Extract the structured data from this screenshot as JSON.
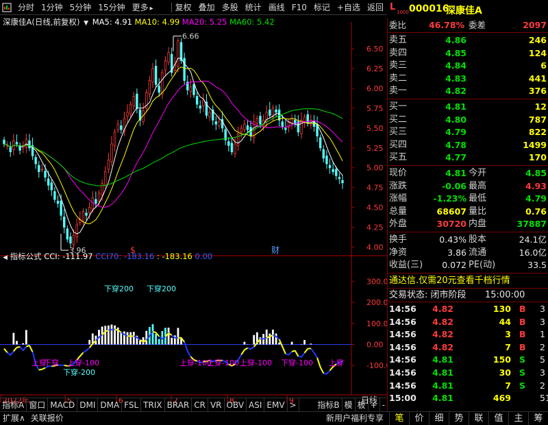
{
  "toolbar": {
    "items": [
      "分时",
      "1分钟",
      "5分钟",
      "15分钟",
      "更多"
    ],
    "more_arrow": "▸",
    "tools": [
      "复权",
      "叠加",
      "多股",
      "统计",
      "画线",
      "F10",
      "标记",
      "+自选",
      "返回"
    ]
  },
  "quote_header": {
    "l_badge": "L",
    "l_sub": "1000",
    "code": "000016",
    "name": "深康佳A"
  },
  "chart_title": {
    "name": "深康佳A",
    "mode": "(日线,前复权)",
    "ma5": "MA5: 4.91",
    "ma10": "MA10: 4.99",
    "ma20": "MA20: 5.25",
    "ma60": "MA60: 5.42"
  },
  "indicator_title": {
    "label": "指标公式",
    "cci": "CCI: -111.97",
    "cci70": "CCI70: -183.16",
    "ma": ": -183.16",
    "zero": "0.00"
  },
  "price_axis": [
    "6.50",
    "6.25",
    "6.00",
    "5.75",
    "5.50",
    "5.25",
    "5.00",
    "4.75",
    "4.50",
    "4.25",
    "4.00"
  ],
  "cci_axis": [
    "300.0",
    "200.0",
    "100.0",
    "0.00",
    "-100.0"
  ],
  "annotations": {
    "high": "6.66",
    "low": "3.96",
    "dollar_mark": "$",
    "cai_mark": "财",
    "down_cross_1": "下穿200",
    "down_cross_2": "下穿200",
    "down_cross_3": "下穿-200",
    "up_cross_label": "上穿-100",
    "down_cross_100": "下穿-100",
    "dense_labels": [
      "上穿",
      "下穿",
      "上穿-100",
      "上穿-100",
      "上穿-100",
      "上穿-100",
      "上穿"
    ]
  },
  "x_axis": [
    "2022年",
    "5",
    "6",
    "7",
    "8",
    "9",
    "日线"
  ],
  "bottom_tabs": [
    "指标A",
    "窗口",
    "MACD",
    "DMI",
    "DMA",
    "FSL",
    "TRIX",
    "BRAR",
    "CR",
    "VR",
    "OBV",
    "ASI",
    "EMV",
    ">",
    "指标B",
    "模",
    "板",
    "+",
    "-"
  ],
  "status_bar": {
    "expand": "扩展∧",
    "related": "关联报价",
    "promo": "新用户福利专享",
    "tabs": [
      "笔",
      "价",
      "细",
      "势",
      "联",
      "值",
      "主",
      "筹"
    ]
  },
  "weibi": {
    "label1": "委比",
    "value1": "46.78%",
    "label2": "委差",
    "value2": "2097"
  },
  "sell": [
    {
      "label": "卖五",
      "price": "4.86",
      "vol": "246"
    },
    {
      "label": "卖四",
      "price": "4.85",
      "vol": "124"
    },
    {
      "label": "卖三",
      "price": "4.84",
      "vol": "6"
    },
    {
      "label": "卖二",
      "price": "4.83",
      "vol": "441"
    },
    {
      "label": "卖一",
      "price": "4.82",
      "vol": "376"
    }
  ],
  "buy": [
    {
      "label": "买一",
      "price": "4.81",
      "vol": "12"
    },
    {
      "label": "买二",
      "price": "4.80",
      "vol": "787"
    },
    {
      "label": "买三",
      "price": "4.79",
      "vol": "822"
    },
    {
      "label": "买四",
      "price": "4.78",
      "vol": "1499"
    },
    {
      "label": "买五",
      "price": "4.77",
      "vol": "170"
    }
  ],
  "stats": [
    {
      "l1": "现价",
      "v1": "4.81",
      "c1": "green",
      "l2": "今开",
      "v2": "4.85",
      "c2": "green"
    },
    {
      "l1": "涨跌",
      "v1": "-0.06",
      "c1": "green",
      "l2": "最高",
      "v2": "4.93",
      "c2": "red"
    },
    {
      "l1": "涨幅",
      "v1": "-1.23%",
      "c1": "green",
      "l2": "最低",
      "v2": "4.79",
      "c2": "green"
    },
    {
      "l1": "总量",
      "v1": "68607",
      "c1": "yellow",
      "l2": "量比",
      "v2": "0.76",
      "c2": "yellow"
    },
    {
      "l1": "外盘",
      "v1": "30720",
      "c1": "red",
      "l2": "内盘",
      "v2": "37887",
      "c2": "green"
    }
  ],
  "stats2": [
    {
      "l1": "换手",
      "v1": "0.43%",
      "l2": "股本",
      "v2": "24.1亿"
    },
    {
      "l1": "净资",
      "v1": "3.86",
      "l2": "流通",
      "v2": "16.0亿"
    },
    {
      "l1": "收益(三)",
      "v1": "0.072",
      "l2": "PE(动)",
      "v2": "33.5"
    }
  ],
  "promo_banner": "通达信.仅需20元查看千档行情",
  "trade_status": {
    "label": "交易状态: 闭市阶段",
    "time": "15:00:00"
  },
  "ticks": [
    {
      "time": "14:56",
      "price": "4.82",
      "vol": "130",
      "bs": "B",
      "n": "3",
      "bsColor": "red",
      "pc": "red",
      "vc": "yellow"
    },
    {
      "time": "14:56",
      "price": "4.82",
      "vol": "44",
      "bs": "B",
      "n": "3",
      "bsColor": "red",
      "pc": "red",
      "vc": "yellow"
    },
    {
      "time": "14:56",
      "price": "4.82",
      "vol": "3",
      "bs": "B",
      "n": "1",
      "bsColor": "red",
      "pc": "red",
      "vc": "yellow"
    },
    {
      "time": "14:56",
      "price": "4.82",
      "vol": "7",
      "bs": "B",
      "n": "2",
      "bsColor": "red",
      "pc": "red",
      "vc": "yellow"
    },
    {
      "time": "14:56",
      "price": "4.81",
      "vol": "150",
      "bs": "S",
      "n": "5",
      "bsColor": "green",
      "pc": "green",
      "vc": "yellow"
    },
    {
      "time": "14:56",
      "price": "4.81",
      "vol": "30",
      "bs": "S",
      "n": "3",
      "bsColor": "green",
      "pc": "green",
      "vc": "yellow"
    },
    {
      "time": "14:56",
      "price": "4.81",
      "vol": "7",
      "bs": "S",
      "n": "2",
      "bsColor": "green",
      "pc": "green",
      "vc": "yellow"
    },
    {
      "time": "15:00",
      "price": "4.81",
      "vol": "469",
      "bs": "",
      "n": "51",
      "bsColor": "green",
      "pc": "green",
      "vc": "yellow"
    }
  ],
  "chart_data": [
    {
      "type": "candlestick",
      "ylim": [
        3.9,
        6.7
      ],
      "series": [
        {
          "name": "MA5",
          "color": "#ffffff"
        },
        {
          "name": "MA10",
          "color": "#ffff00"
        },
        {
          "name": "MA20",
          "color": "#ff00ff"
        },
        {
          "name": "MA60",
          "color": "#00e000"
        }
      ],
      "closes": [
        5.3,
        5.28,
        5.2,
        5.34,
        5.3,
        5.22,
        5.28,
        5.36,
        5.25,
        5.15,
        5.05,
        4.95,
        4.98,
        4.88,
        4.78,
        4.72,
        4.6,
        4.55,
        4.4,
        4.25,
        4.1,
        4.05,
        4.15,
        4.28,
        4.35,
        4.45,
        4.4,
        4.5,
        4.62,
        4.55,
        4.68,
        4.8,
        4.95,
        5.1,
        5.3,
        5.45,
        5.55,
        5.48,
        5.62,
        5.7,
        5.8,
        5.9,
        5.75,
        5.6,
        5.72,
        5.95,
        6.1,
        6.25,
        6.05,
        5.95,
        6.2,
        6.35,
        6.45,
        6.2,
        6.3,
        6.6,
        6.35,
        6.1,
        5.98,
        6.02,
        5.92,
        5.8,
        5.75,
        5.85,
        5.66,
        5.7,
        5.6,
        5.55,
        5.58,
        5.5,
        5.35,
        5.28,
        5.2,
        5.3,
        5.42,
        5.5,
        5.55,
        5.48,
        5.4,
        5.58,
        5.62,
        5.55,
        5.6,
        5.7,
        5.66,
        5.75,
        5.7,
        5.6,
        5.52,
        5.48,
        5.58,
        5.62,
        5.55,
        5.45,
        5.6,
        5.64,
        5.56,
        5.6,
        5.52,
        5.4,
        5.25,
        5.12,
        5.05,
        5.0,
        4.95,
        4.9,
        4.86,
        4.81
      ]
    },
    {
      "type": "bar+line",
      "ylim": [
        -220,
        360
      ],
      "series": [
        {
          "name": "CCI",
          "color": "#ffffff"
        },
        {
          "name": "CCI70",
          "color": "#0000ff"
        }
      ]
    }
  ]
}
